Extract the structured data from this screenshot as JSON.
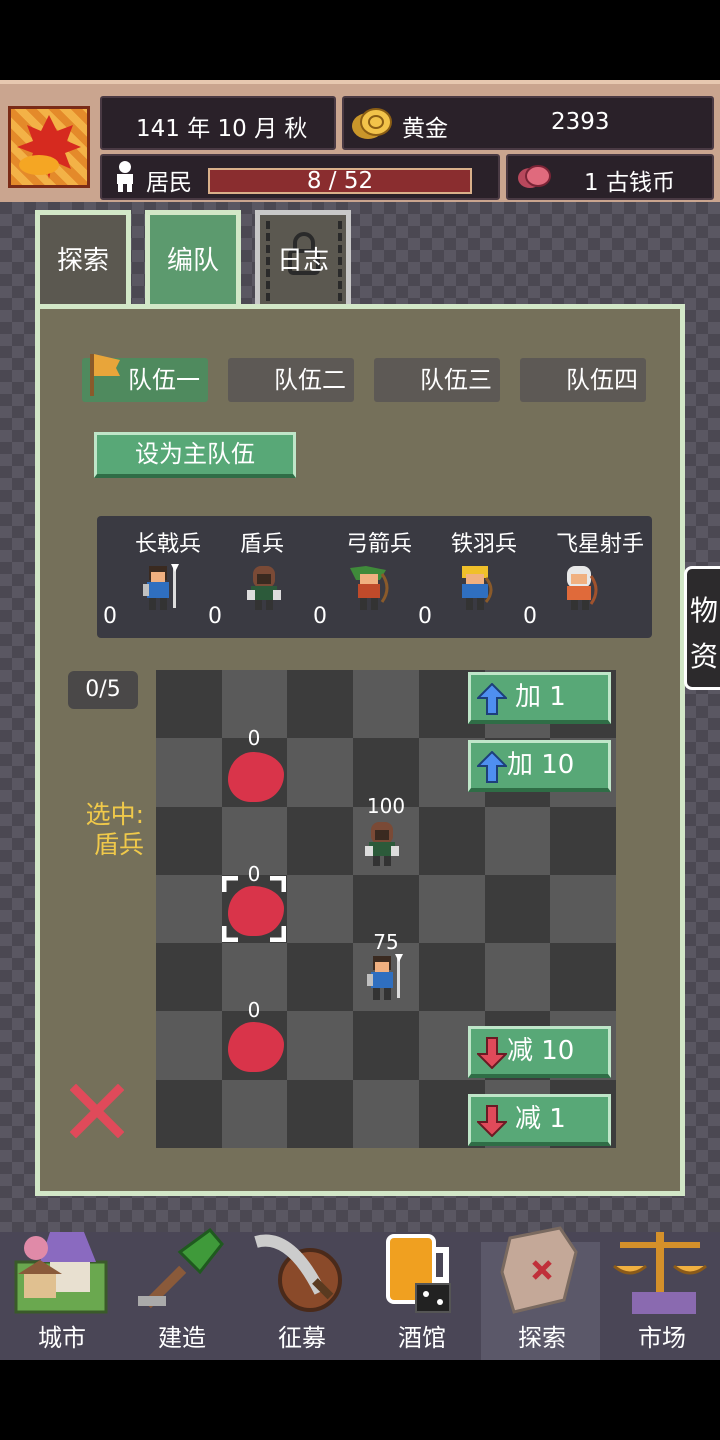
{
  "header": {
    "date": "141 年 10 月 秋",
    "gold_label": "黄金",
    "gold_value": "2393",
    "residents_label": "居民",
    "residents_value": "8 / 52",
    "coin_value": "1 古钱币"
  },
  "tabs": [
    {
      "label": "探索"
    },
    {
      "label": "编队"
    },
    {
      "label": "日志"
    }
  ],
  "teams": [
    "队伍一",
    "队伍二",
    "队伍三",
    "队伍四"
  ],
  "set_main_label": "设为主队伍",
  "units": [
    {
      "name": "长戟兵",
      "count": "0"
    },
    {
      "name": "盾兵",
      "count": "0"
    },
    {
      "name": "弓箭兵",
      "count": "0"
    },
    {
      "name": "铁羽兵",
      "count": "0"
    },
    {
      "name": "飞星射手",
      "count": "0"
    }
  ],
  "selection": {
    "capacity": "0/5",
    "selected_prefix": "选中:",
    "selected_unit": "盾兵"
  },
  "grid": {
    "values": [
      "0",
      "100",
      "0",
      "75",
      "0"
    ]
  },
  "buttons": {
    "add1": "加 1",
    "add10": "加 10",
    "sub10": "减 10",
    "sub1": "减 1"
  },
  "side_tab": [
    "物",
    "资"
  ],
  "nav": [
    {
      "label": "城市"
    },
    {
      "label": "建造"
    },
    {
      "label": "征募"
    },
    {
      "label": "酒馆"
    },
    {
      "label": "探索"
    },
    {
      "label": "市场"
    }
  ],
  "colors": {
    "panel": "#75705a",
    "button": "#58a877",
    "accent_yellow": "#f0c94a",
    "danger": "#d9344a"
  }
}
